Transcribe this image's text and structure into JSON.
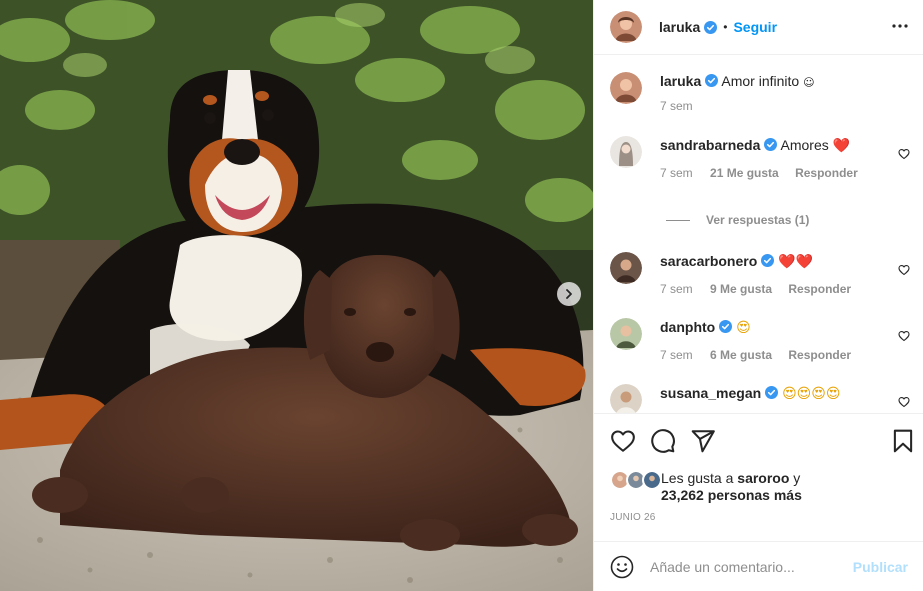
{
  "post": {
    "author": "laruka",
    "verified": true,
    "follow_label": "Seguir",
    "more_icon": "more-horizontal-icon"
  },
  "caption": {
    "username": "laruka",
    "text": "Amor infinito",
    "emoji": "☺",
    "time": "7 sem"
  },
  "comments": [
    {
      "username": "sandrabarneda",
      "text": "Amores",
      "emoji": "❤️",
      "time": "7 sem",
      "likes": "21 Me gusta",
      "reply": "Responder"
    },
    {
      "username": "saracarbonero",
      "text": "",
      "emoji": "❤️❤️",
      "time": "7 sem",
      "likes": "9 Me gusta",
      "reply": "Responder"
    },
    {
      "username": "danphto",
      "text": "",
      "emoji": "😍",
      "time": "7 sem",
      "likes": "6 Me gusta",
      "reply": "Responder"
    },
    {
      "username": "susana_megan",
      "text": "",
      "emoji": "😍😍😍😍",
      "time": "",
      "likes": "",
      "reply": ""
    }
  ],
  "view_replies": "Ver respuestas (1)",
  "likes": {
    "prefix": "Les gusta a",
    "user": "saroroo",
    "joiner": "y",
    "count_text": "23,262 personas más"
  },
  "date": "JUNIO 26",
  "comment_box": {
    "placeholder": "Añade un comentario...",
    "publish_label": "Publicar"
  },
  "colors": {
    "accent": "#0095f6",
    "verified": "#3897f0",
    "publish_disabled": "#b2dffc",
    "muted": "#8e8e8e"
  },
  "icons": [
    "heart-icon",
    "comment-icon",
    "share-icon",
    "bookmark-icon",
    "smile-icon",
    "chevron-right-icon",
    "verified-badge-icon"
  ]
}
